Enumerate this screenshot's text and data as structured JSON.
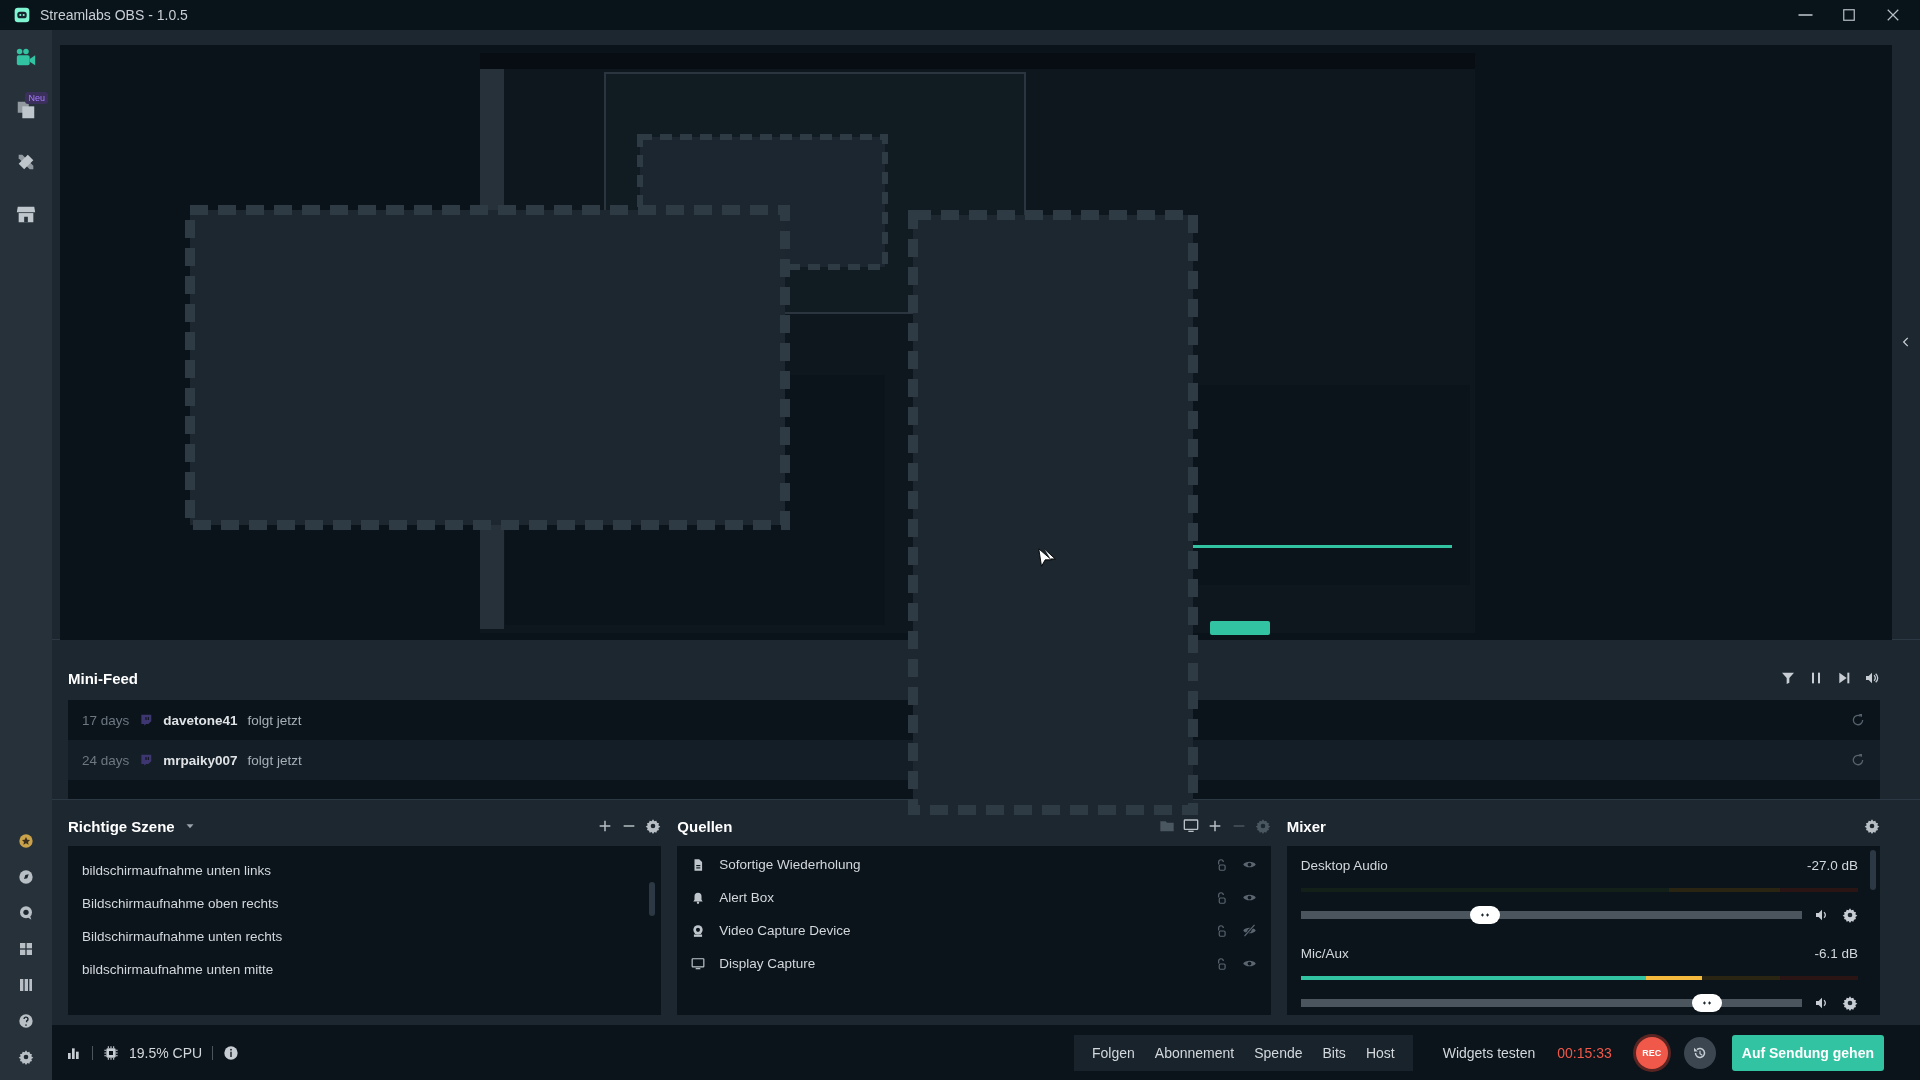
{
  "window": {
    "title": "Streamlabs OBS - 1.0.5"
  },
  "sidebar": {
    "items": [
      {
        "kind": "studio",
        "selected": true
      },
      {
        "kind": "layers",
        "selected": false,
        "badge": "Neu"
      },
      {
        "kind": "tools",
        "selected": false
      },
      {
        "kind": "store",
        "selected": false
      }
    ]
  },
  "mini_feed": {
    "title": "Mini-Feed",
    "events": [
      {
        "time": "17 days",
        "user": "davetone41",
        "action": "folgt jetzt"
      },
      {
        "time": "24 days",
        "user": "mrpaiky007",
        "action": "folgt jetzt"
      }
    ]
  },
  "scenes": {
    "title": "Richtige Szene",
    "items": [
      "bildschirmaufnahme unten links",
      "Bildschirmaufnahme oben rechts",
      "Bildschirmaufnahme unten rechts",
      "bildschirmaufnahme unten mitte"
    ]
  },
  "sources": {
    "title": "Quellen",
    "items": [
      {
        "kind": "file",
        "name": "Sofortige Wiederholung",
        "visible": true
      },
      {
        "kind": "alert",
        "name": "Alert Box",
        "visible": true
      },
      {
        "kind": "camera",
        "name": "Video Capture Device",
        "visible": false
      },
      {
        "kind": "display",
        "name": "Display Capture",
        "visible": true
      }
    ]
  },
  "mixer": {
    "title": "Mixer",
    "channels": [
      {
        "name": "Desktop Audio",
        "reading": "-27.0 dB",
        "fader": {
          "level": 0.36
        }
      },
      {
        "name": "Mic/Aux",
        "reading": "-6.1 dB",
        "meter": {
          "level": 0.72
        },
        "fader": {
          "level": 0.83
        }
      }
    ]
  },
  "status_bar": {
    "cpu": "19.5% CPU",
    "alert_buttons": [
      "Folgen",
      "Abonnement",
      "Spende",
      "Bits",
      "Host"
    ],
    "test_widgets": "Widgets testen",
    "timer": "00:15:33",
    "rec": "REC",
    "go_live": "Auf Sendung gehen"
  }
}
